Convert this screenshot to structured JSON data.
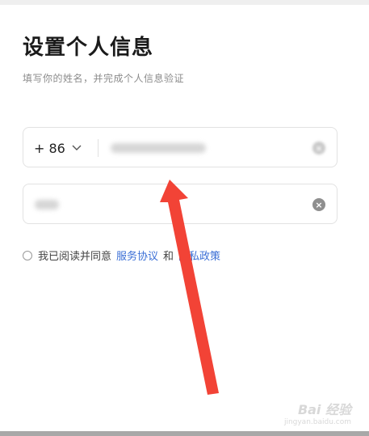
{
  "header": {
    "title": "设置个人信息",
    "subtitle": "填写你的姓名，并完成个人信息验证"
  },
  "phone_field": {
    "country_code": "+ 86",
    "value_state": "blurred"
  },
  "name_field": {
    "value_state": "blurred"
  },
  "agreement": {
    "prefix": "我已阅读并同意",
    "service_link": "服务协议",
    "separator": "和",
    "privacy_link": "隐私政策"
  },
  "watermark": {
    "logo": "Bai 经验",
    "url": "jingyan.baidu.com"
  },
  "colors": {
    "link": "#3b6fd6",
    "annotation_arrow": "#f24336"
  },
  "icons": [
    "chevron-down-icon",
    "clear-icon",
    "radio-icon",
    "arrow-annotation"
  ]
}
